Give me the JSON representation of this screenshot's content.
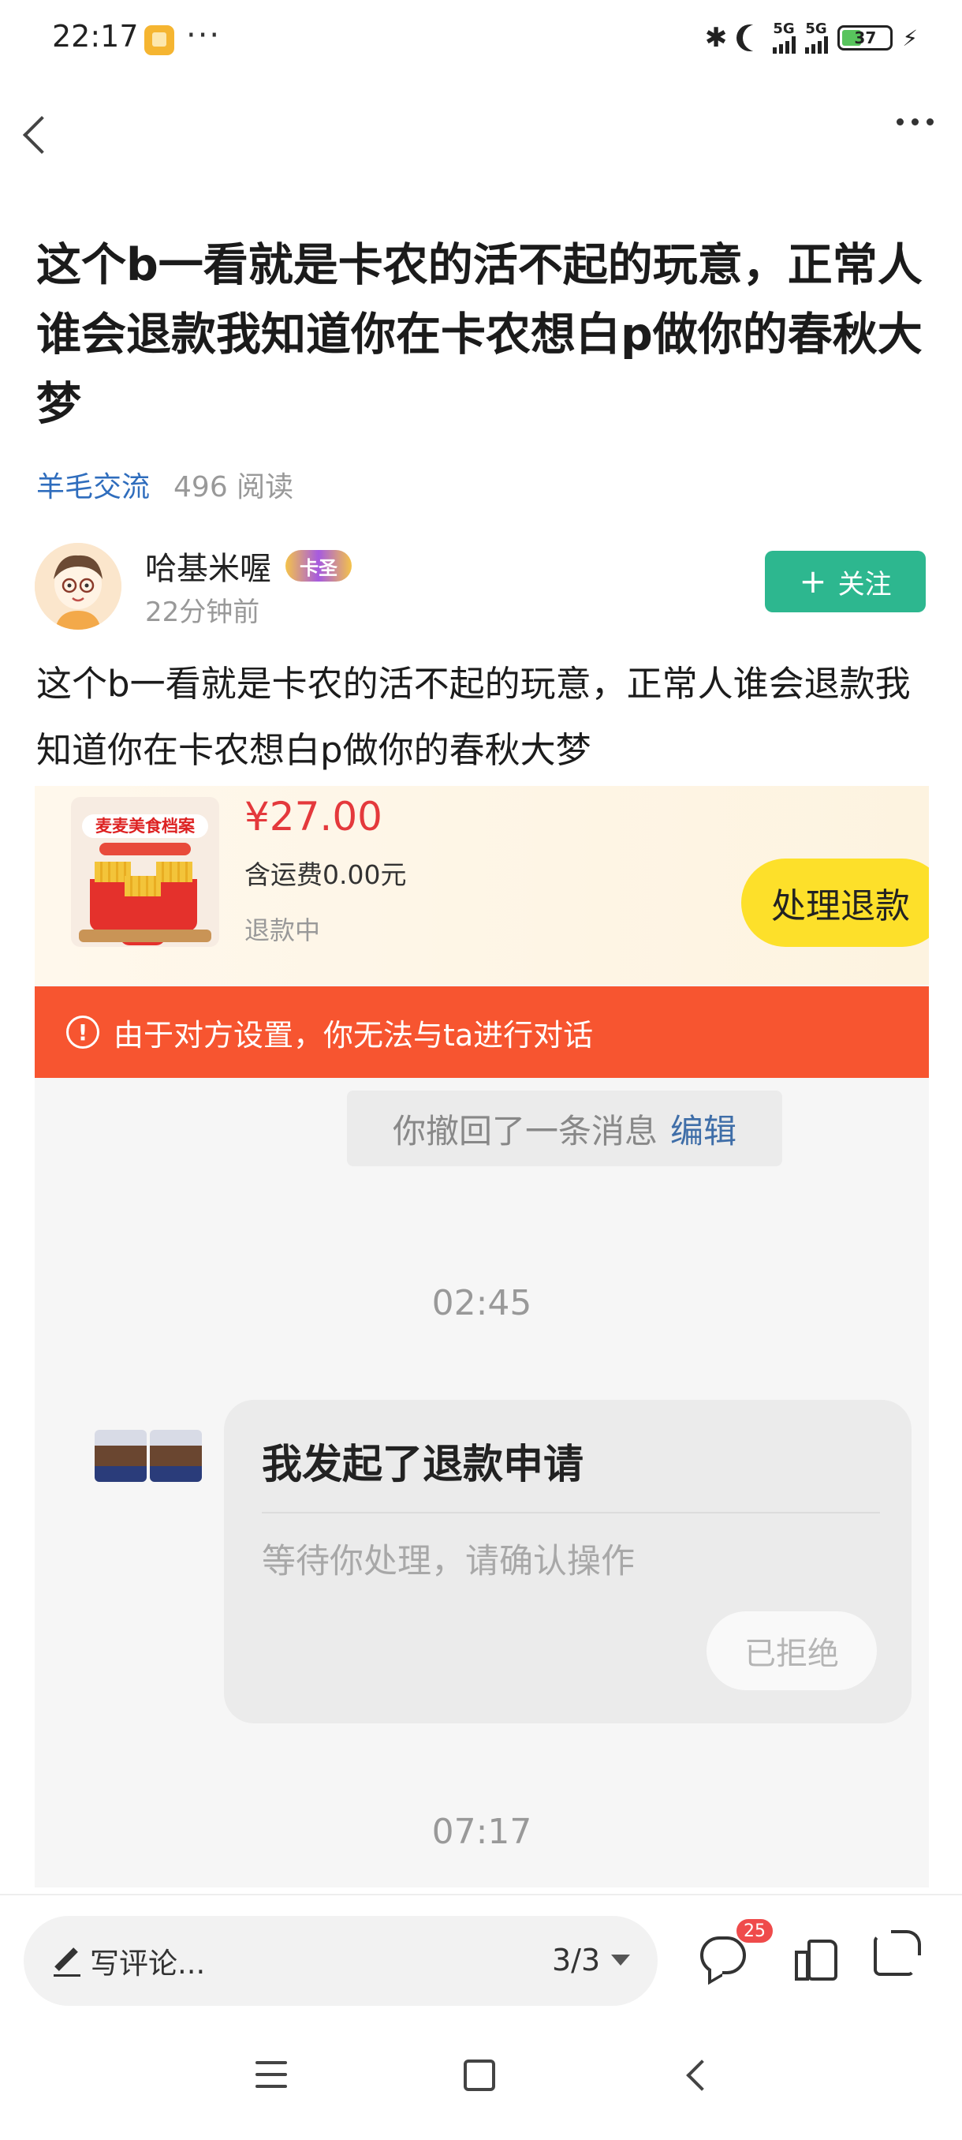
{
  "status_bar": {
    "time": "22:17",
    "notification_dots": "···",
    "signal1_label": "5G",
    "signal2_label": "5G",
    "battery": "37",
    "battery_level": 0.37
  },
  "post": {
    "title": "这个b一看就是卡农的活不起的玩意，正常人谁会退款我知道你在卡农想白p做你的春秋大梦",
    "category": "羊毛交流",
    "reads": "496 阅读",
    "author": {
      "name": "哈基米喔",
      "badge": "卡圣",
      "time": "22分钟前"
    },
    "follow_label": "关注",
    "body": "这个b一看就是卡农的活不起的玩意，正常人谁会退款我知道你在卡农想白p做你的春秋大梦"
  },
  "screenshot": {
    "product_banner": "麦麦美食档案",
    "price": "¥27.00",
    "shipping": "含运费0.00元",
    "refund_status": "退款中",
    "handle_button": "处理退款",
    "warning": "由于对方设置，你无法与ta进行对话",
    "recall_text": "你撤回了一条消息",
    "recall_edit": "编辑",
    "time1": "02:45",
    "card_title": "我发起了退款申请",
    "card_sub": "等待你处理，请确认操作",
    "card_status": "已拒绝",
    "time2": "07:17"
  },
  "bottom_bar": {
    "comment_placeholder": "写评论...",
    "pager": "3/3",
    "comment_count": "25"
  },
  "icons": {
    "back": "chevron-left-icon",
    "more": "more-icon",
    "comment": "comment-icon",
    "like": "thumbs-up-icon",
    "share": "share-icon"
  },
  "colors": {
    "accent_green": "#2db78f",
    "category_blue": "#2f6dbd",
    "price_red": "#e4393c",
    "warning_orange": "#f75530",
    "handle_yellow": "#fde02a"
  }
}
